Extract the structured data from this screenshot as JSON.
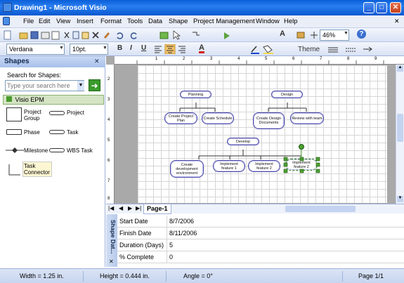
{
  "window": {
    "title": "Drawing1 - Microsoft Visio",
    "min_glyph": "_",
    "max_glyph": "□",
    "close_glyph": "✕"
  },
  "menu": {
    "items": [
      "File",
      "Edit",
      "View",
      "Insert",
      "Format",
      "Tools",
      "Data",
      "Shape",
      "Project Management",
      "Window",
      "Help"
    ],
    "close_glyph": "✕"
  },
  "toolbar": {
    "zoom": "46%",
    "font": "Verdana",
    "size": "10pt.",
    "bold": "B",
    "italic": "I",
    "underline": "U",
    "theme": "Theme",
    "text_glyph": "A",
    "help_glyph": "?"
  },
  "shapes_pane": {
    "title": "Shapes",
    "close_glyph": "✕",
    "search_label": "Search for Shapes:",
    "search_placeholder": "Type your search here",
    "go_glyph": "➜",
    "stencil": "Visio EPM",
    "items": [
      {
        "label": "Project Group"
      },
      {
        "label": "Project"
      },
      {
        "label": "Phase"
      },
      {
        "label": "Task"
      },
      {
        "label": "Milestone"
      },
      {
        "label": "WBS Task"
      },
      {
        "label": "Task Connector"
      }
    ]
  },
  "diagram": {
    "nodes": [
      {
        "label": "Planning"
      },
      {
        "label": "Design"
      },
      {
        "label": "Create Project Plan"
      },
      {
        "label": "Create Schedule"
      },
      {
        "label": "Create Design Documents"
      },
      {
        "label": "Review with team"
      },
      {
        "label": "Develop"
      },
      {
        "label": "Create development environment"
      },
      {
        "label": "Implement feature 1"
      },
      {
        "label": "Implement feature 2"
      },
      {
        "label": "Implement feature 2"
      }
    ]
  },
  "ruler_h_labels": [
    "1",
    "2",
    "3",
    "4",
    "5",
    "6",
    "7",
    "8",
    "9"
  ],
  "ruler_v_labels": [
    "2",
    "3",
    "4",
    "5",
    "6",
    "7",
    "8"
  ],
  "page_tabs": {
    "active": "Page-1"
  },
  "shape_data": {
    "title": "Shape Dat...",
    "close_glyph": "✕",
    "rows": [
      {
        "key": "Start Date",
        "value": "8/7/2006"
      },
      {
        "key": "Finish Date",
        "value": "8/11/2006"
      },
      {
        "key": "Duration (Days)",
        "value": "5"
      },
      {
        "key": "% Complete",
        "value": "0"
      }
    ]
  },
  "status": {
    "width": "Width = 1.25 in.",
    "height": "Height = 0.444 in.",
    "angle": "Angle = 0°",
    "page": "Page 1/1"
  }
}
